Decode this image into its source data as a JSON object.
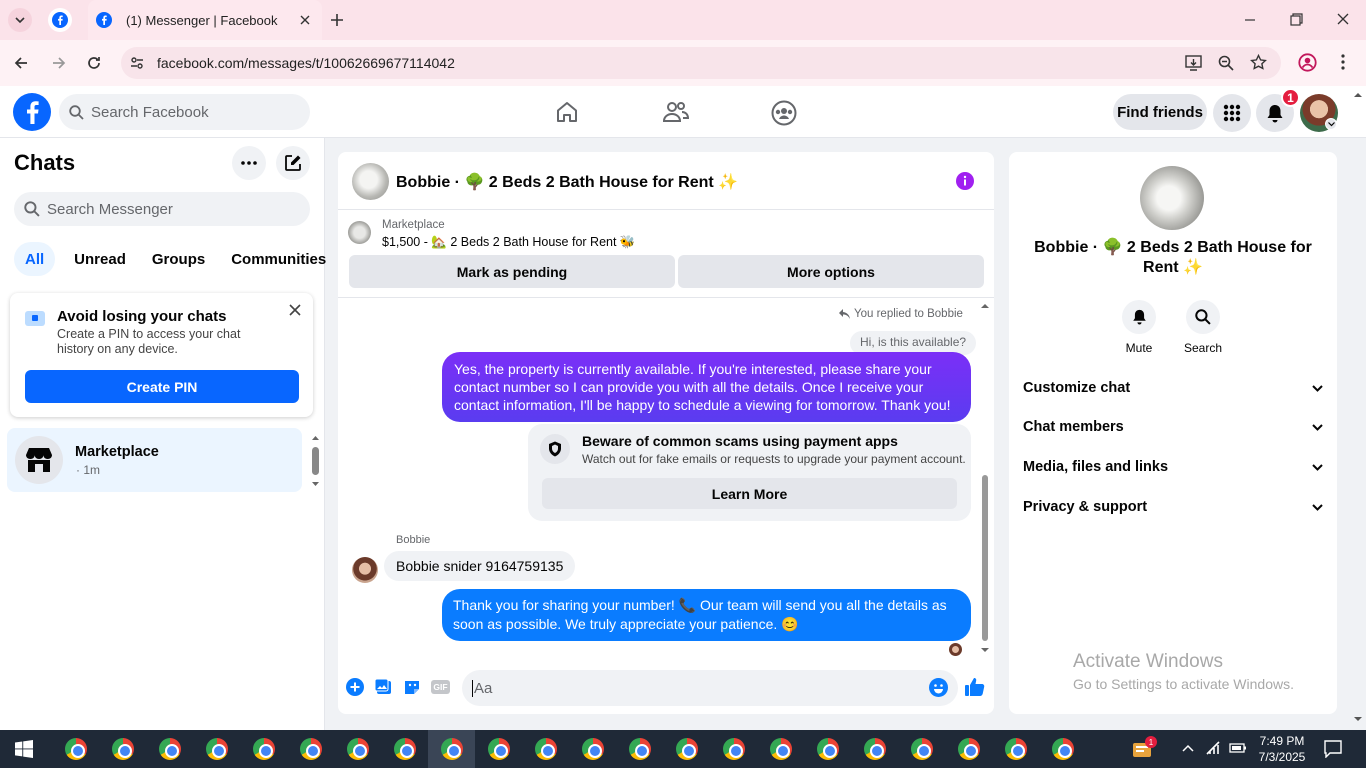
{
  "browser": {
    "tab_title": "(1) Messenger | Facebook",
    "url": "facebook.com/messages/t/10062669677114042"
  },
  "fb_header": {
    "search_placeholder": "Search Facebook",
    "find_friends": "Find friends",
    "notification_count": "1"
  },
  "left": {
    "title": "Chats",
    "search_placeholder": "Search Messenger",
    "filters": [
      "All",
      "Unread",
      "Groups",
      "Communities"
    ],
    "pin_card": {
      "title": "Avoid losing your chats",
      "body": "Create a PIN to access your chat history on any device.",
      "button": "Create PIN"
    },
    "chat_item": {
      "name": "Marketplace",
      "meta": "· 1m"
    }
  },
  "conversation": {
    "header_title": "Bobbie · 🌳 2 Beds 2 Bath House for Rent ✨",
    "listing_label": "Marketplace",
    "listing_title": "$1,500 - 🏡 2 Beds 2 Bath House for Rent 🐝",
    "mark_pending": "Mark as pending",
    "more_options": "More options",
    "replied_to": "You replied to Bobbie",
    "quoted": "Hi, is this available?",
    "msg1": "Yes, the property is currently available. If you're interested, please share your contact number so I can provide you with all the details. Once I receive your contact information, I'll be happy to schedule a viewing for tomorrow. Thank you!",
    "warning_title": "Beware of common scams using payment apps",
    "warning_body": "Watch out for fake emails or requests to upgrade your payment account.",
    "learn_more": "Learn More",
    "sender_name": "Bobbie",
    "msg2": "Bobbie snider 9164759135",
    "msg3": "Thank you for sharing your number! 📞 Our team will send you all the details as soon as possible. We truly appreciate your patience. 😊",
    "composer_placeholder": "Aa"
  },
  "right": {
    "name": "Bobbie · 🌳 2 Beds 2 Bath House for Rent ✨",
    "mute": "Mute",
    "search": "Search",
    "sections": [
      "Customize chat",
      "Chat members",
      "Media, files and links",
      "Privacy & support"
    ]
  },
  "watermark": {
    "title": "Activate Windows",
    "body": "Go to Settings to activate Windows."
  },
  "taskbar": {
    "time": "7:49 PM",
    "date": "7/3/2025",
    "badge": "1"
  },
  "colors": {
    "fb_blue": "#0866ff",
    "messenger_purple": "#a020f0",
    "bubble_blue": "#0a7cff"
  }
}
